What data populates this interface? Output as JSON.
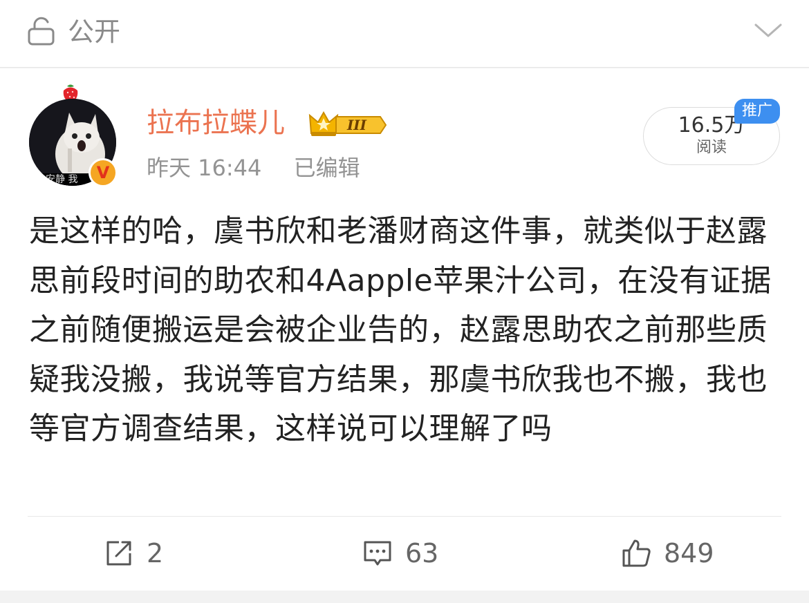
{
  "header": {
    "visibility": "公开",
    "icons": {
      "left": "lock-icon",
      "right": "chevron-down-icon"
    }
  },
  "post": {
    "author": {
      "name": "拉布拉蝶儿",
      "verified_icon_text": "V",
      "crown_level": "III",
      "avatar_caption": "安静 我"
    },
    "meta": {
      "time": "昨天 16:44",
      "edited": "已编辑"
    },
    "reads": {
      "count": "16.5万",
      "label": "阅读",
      "promo_tag": "推广"
    },
    "content": "是这样的哈，虞书欣和老潘财商这件事，就类似于赵露思前段时间的助农和4Aapple苹果汁公司，在没有证据之前随便搬运是会被企业告的，赵露思助农之前那些质疑我没搬，我说等官方结果，那虞书欣我也不搬，我也等官方调查结果，这样说可以理解了吗"
  },
  "actions": {
    "repost_count": "2",
    "comment_count": "63",
    "like_count": "849"
  },
  "colors": {
    "username": "#eb7350",
    "promo": "#3d8ff0",
    "verified": "#f5a623",
    "text": "#222222",
    "muted": "#939393"
  }
}
